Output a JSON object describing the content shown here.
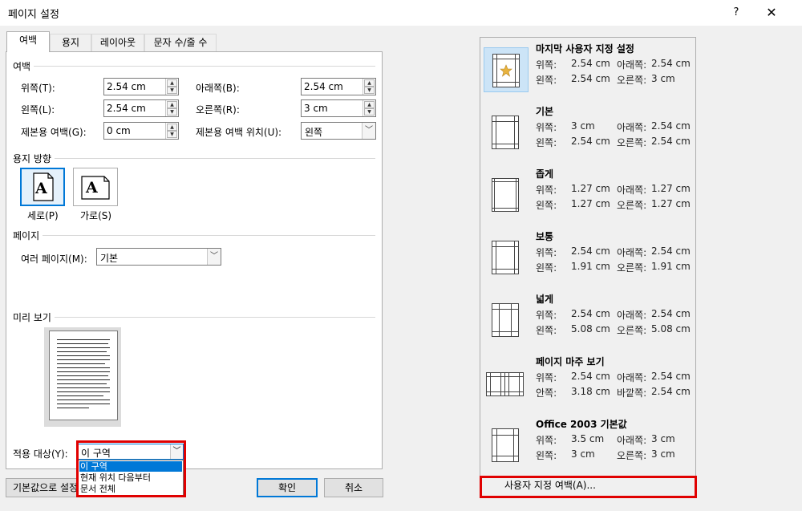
{
  "window": {
    "title": "페이지 설정",
    "help_label": "?",
    "close_label": "✕"
  },
  "tabs": [
    {
      "label": "여백",
      "active": true
    },
    {
      "label": "용지",
      "active": false
    },
    {
      "label": "레이아웃",
      "active": false
    },
    {
      "label": "문자 수/줄 수",
      "active": false
    }
  ],
  "margins": {
    "group_label": "여백",
    "top": {
      "label": "위쪽(T):",
      "value": "2.54 cm"
    },
    "bottom": {
      "label": "아래쪽(B):",
      "value": "2.54 cm"
    },
    "left": {
      "label": "왼쪽(L):",
      "value": "2.54 cm"
    },
    "right": {
      "label": "오른쪽(R):",
      "value": "3 cm"
    },
    "gutter": {
      "label": "제본용 여백(G):",
      "value": "0 cm"
    },
    "gutter_position": {
      "label": "제본용 여백 위치(U):",
      "value": "왼쪽"
    }
  },
  "orientation": {
    "group_label": "용지 방향",
    "portrait_label": "세로(P)",
    "landscape_label": "가로(S)",
    "icon_letter": "A",
    "selected": "portrait"
  },
  "pages": {
    "group_label": "페이지",
    "multiple_label": "여러 페이지(M):",
    "multiple_value": "기본"
  },
  "preview": {
    "group_label": "미리 보기"
  },
  "apply_to": {
    "label": "적용 대상(Y):",
    "value": "이 구역",
    "options": [
      "이 구역",
      "현재 위치 다음부터",
      "문서 전체"
    ],
    "selected_option": "이 구역"
  },
  "buttons": {
    "set_default": "기본값으로 설정",
    "ok": "확인",
    "cancel": "취소"
  },
  "margin_presets": [
    {
      "name": "마지막 사용자 지정 설정",
      "l1": "위쪽:",
      "v1": "2.54 cm",
      "l2": "아래쪽:",
      "v2": "2.54 cm",
      "l3": "왼쪽:",
      "v3": "2.54 cm",
      "l4": "오른쪽:",
      "v4": "3 cm",
      "icon": "star-icon",
      "selected": true
    },
    {
      "name": "기본",
      "l1": "위쪽:",
      "v1": "3 cm",
      "l2": "아래쪽:",
      "v2": "2.54 cm",
      "l3": "왼쪽:",
      "v3": "2.54 cm",
      "l4": "오른쪽:",
      "v4": "2.54 cm",
      "icon": "page-margin-icon",
      "selected": false
    },
    {
      "name": "좁게",
      "l1": "위쪽:",
      "v1": "1.27 cm",
      "l2": "아래쪽:",
      "v2": "1.27 cm",
      "l3": "왼쪽:",
      "v3": "1.27 cm",
      "l4": "오른쪽:",
      "v4": "1.27 cm",
      "icon": "page-margin-icon",
      "selected": false
    },
    {
      "name": "보통",
      "l1": "위쪽:",
      "v1": "2.54 cm",
      "l2": "아래쪽:",
      "v2": "2.54 cm",
      "l3": "왼쪽:",
      "v3": "1.91 cm",
      "l4": "오른쪽:",
      "v4": "1.91 cm",
      "icon": "page-margin-icon",
      "selected": false
    },
    {
      "name": "넓게",
      "l1": "위쪽:",
      "v1": "2.54 cm",
      "l2": "아래쪽:",
      "v2": "2.54 cm",
      "l3": "왼쪽:",
      "v3": "5.08 cm",
      "l4": "오른쪽:",
      "v4": "5.08 cm",
      "icon": "page-margin-icon",
      "selected": false
    },
    {
      "name": "페이지 마주 보기",
      "l1": "위쪽:",
      "v1": "2.54 cm",
      "l2": "아래쪽:",
      "v2": "2.54 cm",
      "l3": "안쪽:",
      "v3": "3.18 cm",
      "l4": "바깥쪽:",
      "v4": "2.54 cm",
      "icon": "mirrored-pages-icon",
      "selected": false
    },
    {
      "name": "Office 2003 기본값",
      "l1": "위쪽:",
      "v1": "3.5 cm",
      "l2": "아래쪽:",
      "v2": "3 cm",
      "l3": "왼쪽:",
      "v3": "3 cm",
      "l4": "오른쪽:",
      "v4": "3 cm",
      "icon": "page-margin-icon",
      "selected": false
    }
  ],
  "custom_margins_label": "사용자 지정 여백(A)...",
  "highlight_color": "#e00000",
  "accent_color": "#0078d7"
}
